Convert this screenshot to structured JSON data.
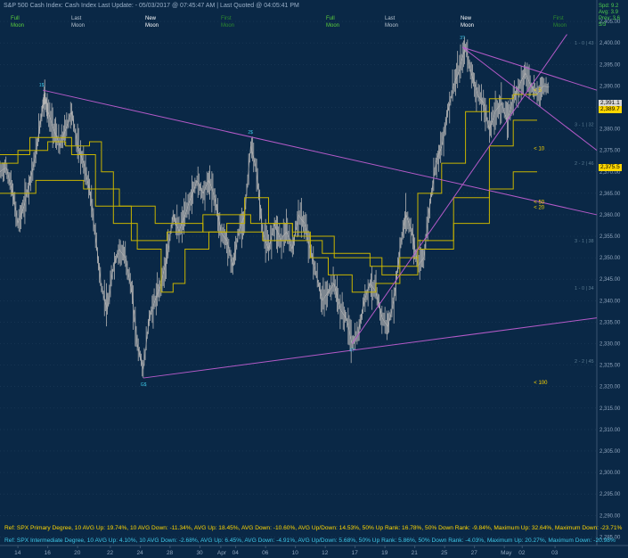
{
  "header": {
    "instrument": "S&P 500 Cash Index:  Cash Index  Last Update:  - 05/03/2017 @ 07:45:47 AM | Last Quoted @ 04:05:41 PM"
  },
  "moon_phases": [
    {
      "label1": "Full",
      "label2": "Moon",
      "color": "#5ccf3c"
    },
    {
      "label1": "Last",
      "label2": "Moon",
      "color": "#b8c4d0"
    },
    {
      "label1": "New",
      "label2": "Moon",
      "color": "#ffffff"
    },
    {
      "label1": "First",
      "label2": "Moon",
      "color": "#2e8b2e"
    },
    {
      "label1": "Full",
      "label2": "Moon",
      "color": "#5ccf3c"
    },
    {
      "label1": "Last",
      "label2": "Moon",
      "color": "#b8c4d0"
    },
    {
      "label1": "New",
      "label2": "Moon",
      "color": "#ffffff"
    },
    {
      "label1": "First",
      "label2": "Moon",
      "color": "#2e8b2e"
    }
  ],
  "stats_box": {
    "line1": "Spd: 9.2",
    "line2": "Avg: 3.9",
    "line3": "Prev: 3.6",
    "line4": "5/3"
  },
  "price_tags": [
    {
      "text": "2,391.1",
      "bg": "#d8d8d8"
    },
    {
      "text": "2,389.7",
      "bg": "#ffd700"
    },
    {
      "text": "2,375.5",
      "bg": "#ffd700"
    }
  ],
  "footer": {
    "primary": "Ref: SPX Primary Degree, 10 AVG Up: 19.74%, 10 AVG Down: -11.34%, AVG Up: 18.45%, AVG Down: -10.60%, AVG Up/Down: 14.53%, 50%  Up Rank: 16.78%, 50% Down Rank: -9.84%, Maximum Up: 32.64%, Maximum Down: -23.71%",
    "intermediate": "Ref: SPX Intermediate Degree, 10 AVG Up: 4.10%, 10 AVG Down: -2.68%, AVG Up: 6.45%, AVG Down: -4.91%, AVG Up/Down: 5.68%, 50%  Up Rank: 5.86%, 50% Down Rank: -4.03%, Maximum Up: 20.27%, Maximum Down: -20.98%",
    "primary_color": "#ffd700",
    "intermediate_color": "#3ec8e8"
  },
  "colors": {
    "background": "#0a2846",
    "price": "#b4b4b4",
    "trendline": "#b45ac8",
    "moving_average": "#c8b400",
    "grid": "#1e3c5a",
    "axis_text": "#8fa4bc",
    "pivot_label": "#3ec8e8",
    "fib_label": "#5a7a90"
  },
  "chart_data": {
    "type": "line",
    "title": "S&P 500 Cash Index",
    "ylim": [
      2283,
      2410
    ],
    "yticks": [
      2285,
      2290,
      2295,
      2300,
      2305,
      2310,
      2315,
      2320,
      2325,
      2330,
      2335,
      2340,
      2345,
      2350,
      2355,
      2360,
      2365,
      2370,
      2375,
      2380,
      2385,
      2390,
      2395,
      2400,
      2405
    ],
    "ytick_labels": [
      "2,285.00",
      "2,290.00",
      "2,295.00",
      "2,300.00",
      "2,305.00",
      "2,310.00",
      "2,315.00",
      "2,320.00",
      "2,325.00",
      "2,330.00",
      "2,335.00",
      "2,340.00",
      "2,345.00",
      "2,350.00",
      "2,355.00",
      "2,360.00",
      "2,365.00",
      "2,370.00",
      "2,375.00",
      "2,380.00",
      "2,385.00",
      "2,390.00",
      "2,395.00",
      "2,400.00",
      "2,405.00"
    ],
    "xlim": [
      0,
      100
    ],
    "xtick_labels": [
      {
        "t": 3,
        "label": "14"
      },
      {
        "t": 8,
        "label": "16"
      },
      {
        "t": 13,
        "label": "20"
      },
      {
        "t": 18.5,
        "label": "22"
      },
      {
        "t": 23.5,
        "label": "24"
      },
      {
        "t": 28.5,
        "label": "28"
      },
      {
        "t": 33.5,
        "label": "30"
      },
      {
        "t": 37,
        "label": "Apr"
      },
      {
        "t": 39.5,
        "label": "04"
      },
      {
        "t": 44.5,
        "label": "06"
      },
      {
        "t": 49.5,
        "label": "10"
      },
      {
        "t": 54.5,
        "label": "12"
      },
      {
        "t": 59.5,
        "label": "17"
      },
      {
        "t": 64.5,
        "label": "19"
      },
      {
        "t": 69.5,
        "label": "21"
      },
      {
        "t": 74.5,
        "label": "25"
      },
      {
        "t": 79.5,
        "label": "27"
      },
      {
        "t": 84.5,
        "label": "May"
      },
      {
        "t": 87.5,
        "label": "02"
      },
      {
        "t": 93,
        "label": "03"
      }
    ],
    "price_series": [
      [
        0,
        2370
      ],
      [
        1,
        2371
      ],
      [
        2,
        2366
      ],
      [
        3,
        2358
      ],
      [
        4,
        2362
      ],
      [
        5,
        2368
      ],
      [
        6,
        2374
      ],
      [
        7,
        2384
      ],
      [
        7.5,
        2388
      ],
      [
        8,
        2384
      ],
      [
        9,
        2380
      ],
      [
        10,
        2376
      ],
      [
        11,
        2380
      ],
      [
        12,
        2384
      ],
      [
        13,
        2376
      ],
      [
        14,
        2372
      ],
      [
        15,
        2366
      ],
      [
        16,
        2355
      ],
      [
        17,
        2343
      ],
      [
        18,
        2338
      ],
      [
        19,
        2348
      ],
      [
        20,
        2352
      ],
      [
        21,
        2350
      ],
      [
        22,
        2343
      ],
      [
        23,
        2330
      ],
      [
        24,
        2324
      ],
      [
        25,
        2336
      ],
      [
        26,
        2340
      ],
      [
        27,
        2344
      ],
      [
        28,
        2350
      ],
      [
        29,
        2360
      ],
      [
        30,
        2356
      ],
      [
        31,
        2360
      ],
      [
        32,
        2364
      ],
      [
        33,
        2368
      ],
      [
        34,
        2365
      ],
      [
        35,
        2368
      ],
      [
        36,
        2364
      ],
      [
        37,
        2356
      ],
      [
        38,
        2354
      ],
      [
        39,
        2348
      ],
      [
        40,
        2356
      ],
      [
        41,
        2360
      ],
      [
        42,
        2376
      ],
      [
        43,
        2370
      ],
      [
        44,
        2356
      ],
      [
        45,
        2352
      ],
      [
        46,
        2358
      ],
      [
        47,
        2354
      ],
      [
        48,
        2356
      ],
      [
        49,
        2352
      ],
      [
        50,
        2360
      ],
      [
        51,
        2358
      ],
      [
        52,
        2352
      ],
      [
        53,
        2346
      ],
      [
        54,
        2340
      ],
      [
        55,
        2342
      ],
      [
        56,
        2344
      ],
      [
        57,
        2338
      ],
      [
        58,
        2336
      ],
      [
        59,
        2330
      ],
      [
        60,
        2332
      ],
      [
        61,
        2340
      ],
      [
        62,
        2344
      ],
      [
        63,
        2342
      ],
      [
        64,
        2336
      ],
      [
        65,
        2334
      ],
      [
        66,
        2340
      ],
      [
        67,
        2352
      ],
      [
        68,
        2360
      ],
      [
        69,
        2356
      ],
      [
        70,
        2348
      ],
      [
        71,
        2350
      ],
      [
        72,
        2362
      ],
      [
        73,
        2372
      ],
      [
        74,
        2376
      ],
      [
        75,
        2384
      ],
      [
        76,
        2390
      ],
      [
        77,
        2394
      ],
      [
        78,
        2399
      ],
      [
        79,
        2393
      ],
      [
        80,
        2388
      ],
      [
        81,
        2386
      ],
      [
        82,
        2380
      ],
      [
        83,
        2384
      ],
      [
        84,
        2386
      ],
      [
        85,
        2382
      ],
      [
        86,
        2387
      ],
      [
        87,
        2390
      ],
      [
        88,
        2393
      ],
      [
        89,
        2390
      ],
      [
        90,
        2388
      ],
      [
        91,
        2390
      ],
      [
        92,
        2389.7
      ]
    ],
    "moving_averages": [
      {
        "name": "10",
        "values": [
          [
            0,
            2372
          ],
          [
            3,
            2372
          ],
          [
            3,
            2375
          ],
          [
            8,
            2375
          ],
          [
            8,
            2377
          ],
          [
            11,
            2377
          ],
          [
            11,
            2376
          ],
          [
            15,
            2376
          ],
          [
            15,
            2377
          ],
          [
            17,
            2377
          ],
          [
            17,
            2370
          ],
          [
            19,
            2370
          ],
          [
            19,
            2358
          ],
          [
            23,
            2358
          ],
          [
            23,
            2352
          ],
          [
            27,
            2352
          ],
          [
            27,
            2342
          ],
          [
            29,
            2342
          ],
          [
            29,
            2344
          ],
          [
            31,
            2344
          ],
          [
            31,
            2352
          ],
          [
            35,
            2352
          ],
          [
            35,
            2356
          ],
          [
            38,
            2356
          ],
          [
            38,
            2358
          ],
          [
            41,
            2358
          ],
          [
            41,
            2364
          ],
          [
            45,
            2364
          ],
          [
            45,
            2358
          ],
          [
            49,
            2358
          ],
          [
            49,
            2356
          ],
          [
            52,
            2356
          ],
          [
            52,
            2350
          ],
          [
            55,
            2350
          ],
          [
            55,
            2346
          ],
          [
            59,
            2346
          ],
          [
            59,
            2342
          ],
          [
            63,
            2342
          ],
          [
            63,
            2344
          ],
          [
            67,
            2344
          ],
          [
            67,
            2350
          ],
          [
            70,
            2350
          ],
          [
            70,
            2365
          ],
          [
            74,
            2365
          ],
          [
            74,
            2372
          ],
          [
            78,
            2372
          ],
          [
            78,
            2384
          ],
          [
            82,
            2384
          ],
          [
            82,
            2387
          ],
          [
            86,
            2387
          ],
          [
            86,
            2388
          ],
          [
            90,
            2388
          ]
        ]
      },
      {
        "name": "20",
        "values": [
          [
            0,
            2374
          ],
          [
            5,
            2374
          ],
          [
            5,
            2378
          ],
          [
            12,
            2378
          ],
          [
            12,
            2374
          ],
          [
            16,
            2374
          ],
          [
            16,
            2362
          ],
          [
            22,
            2362
          ],
          [
            22,
            2354
          ],
          [
            28,
            2354
          ],
          [
            28,
            2356
          ],
          [
            34,
            2356
          ],
          [
            34,
            2360
          ],
          [
            42,
            2360
          ],
          [
            42,
            2358
          ],
          [
            49,
            2358
          ],
          [
            49,
            2355
          ],
          [
            56,
            2355
          ],
          [
            56,
            2350
          ],
          [
            64,
            2350
          ],
          [
            64,
            2346
          ],
          [
            70,
            2346
          ],
          [
            70,
            2354
          ],
          [
            76,
            2354
          ],
          [
            76,
            2364
          ],
          [
            82,
            2364
          ],
          [
            82,
            2376
          ],
          [
            86,
            2376
          ],
          [
            86,
            2382
          ],
          [
            90,
            2382
          ]
        ]
      },
      {
        "name": "50",
        "values": [
          [
            0,
            2365
          ],
          [
            6,
            2365
          ],
          [
            6,
            2368
          ],
          [
            14,
            2368
          ],
          [
            14,
            2366
          ],
          [
            20,
            2366
          ],
          [
            20,
            2362
          ],
          [
            26,
            2362
          ],
          [
            26,
            2358
          ],
          [
            34,
            2358
          ],
          [
            34,
            2356
          ],
          [
            44,
            2356
          ],
          [
            44,
            2354
          ],
          [
            54,
            2354
          ],
          [
            54,
            2351
          ],
          [
            62,
            2351
          ],
          [
            62,
            2348
          ],
          [
            70,
            2348
          ],
          [
            70,
            2352
          ],
          [
            76,
            2352
          ],
          [
            76,
            2358
          ],
          [
            82,
            2358
          ],
          [
            82,
            2366
          ],
          [
            86,
            2366
          ],
          [
            86,
            2370
          ],
          [
            90,
            2370
          ]
        ]
      }
    ],
    "trendlines": [
      {
        "from": [
          7.2,
          2389
        ],
        "to": [
          100,
          2360
        ]
      },
      {
        "from": [
          24,
          2322
        ],
        "to": [
          100,
          2336
        ]
      },
      {
        "from": [
          59,
          2330
        ],
        "to": [
          95,
          2402
        ]
      },
      {
        "from": [
          77.5,
          2399
        ],
        "to": [
          100,
          2375
        ]
      },
      {
        "from": [
          77.5,
          2399
        ],
        "to": [
          100,
          2389
        ]
      }
    ],
    "pivots": [
      {
        "t": 7,
        "v": 2389,
        "label": "1$"
      },
      {
        "t": 24,
        "v": 2322,
        "label": "G$"
      },
      {
        "t": 42,
        "v": 2378,
        "label": "2$"
      },
      {
        "t": 59,
        "v": 2330,
        "label": "4?"
      },
      {
        "t": 77.5,
        "v": 2400,
        "label": "3?"
      }
    ],
    "fib_labels": [
      {
        "v": 2400,
        "text": "1 - 0 | 43"
      },
      {
        "v": 2381,
        "text": "3 - 1 | 32"
      },
      {
        "v": 2372,
        "text": "2 - 2 | 46"
      },
      {
        "v": 2354,
        "text": "3 - 1 | 38"
      },
      {
        "v": 2343,
        "text": "1 - 0 | 34"
      },
      {
        "v": 2326,
        "text": "2 - 2 | 45"
      }
    ],
    "ma_labels": [
      {
        "t": 89,
        "v": 2389,
        "text": "< 5"
      },
      {
        "t": 89,
        "v": 2375.5,
        "text": "< 10"
      },
      {
        "t": 89,
        "v": 2363,
        "text": "< 50"
      },
      {
        "t": 89,
        "v": 2361.8,
        "text": "< 20"
      },
      {
        "t": 89,
        "v": 2321,
        "text": "< 100"
      }
    ]
  }
}
